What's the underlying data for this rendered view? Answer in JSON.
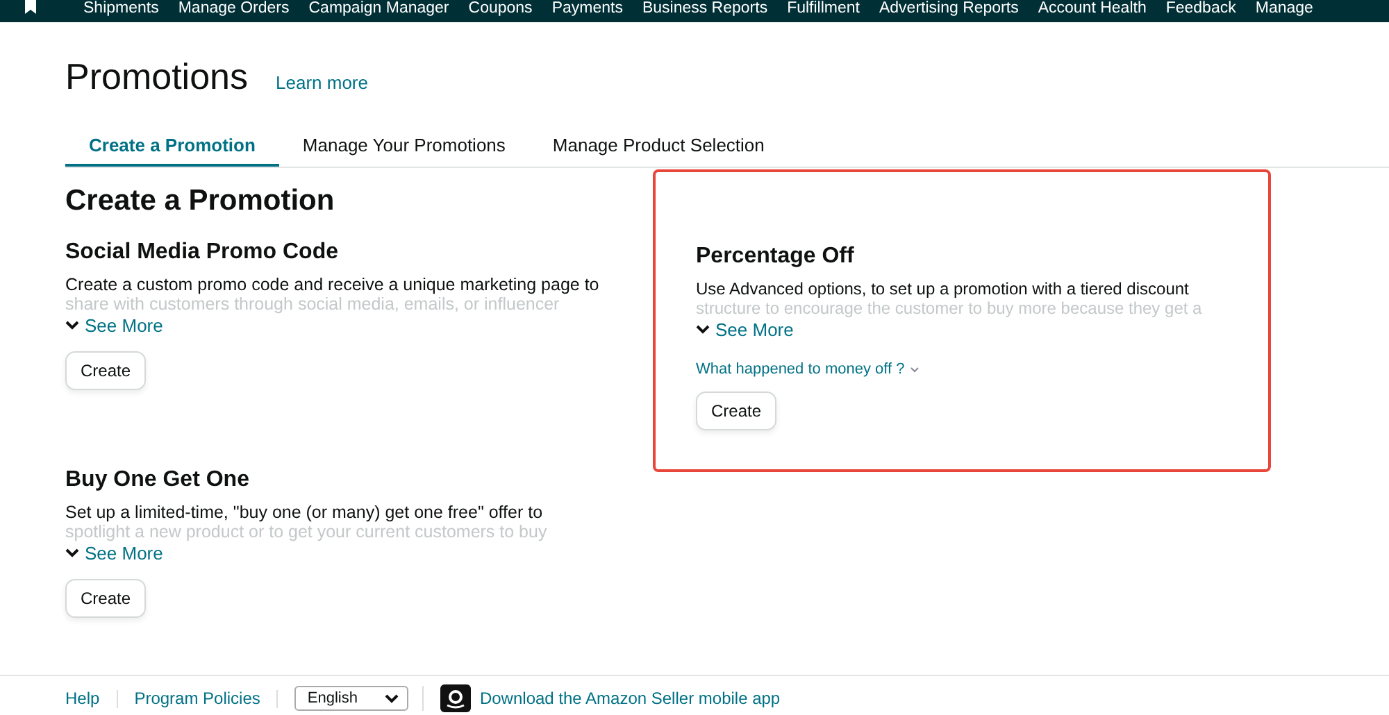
{
  "nav": {
    "items": [
      "Shipments",
      "Manage Orders",
      "Campaign Manager",
      "Coupons",
      "Payments",
      "Business Reports",
      "Fulfillment",
      "Advertising Reports",
      "Account Health",
      "Feedback",
      "Manage"
    ]
  },
  "page": {
    "title": "Promotions",
    "learn_more": "Learn more"
  },
  "tabs": [
    {
      "label": "Create a Promotion",
      "selected": true
    },
    {
      "label": "Manage Your Promotions",
      "selected": false
    },
    {
      "label": "Manage Product Selection",
      "selected": false
    }
  ],
  "section_title": "Create a Promotion",
  "promotions": [
    {
      "title": "Social Media Promo Code",
      "description": "Create a custom promo code and receive a unique marketing page to",
      "description_faded": "share with customers through social media, emails, or influencer",
      "see_more": "See More",
      "create": "Create",
      "highlighted": false
    },
    {
      "title": "Percentage Off",
      "description": "Use Advanced options, to set up a promotion with a tiered discount",
      "description_faded": "structure to encourage the customer to buy more because they get a",
      "see_more": "See More",
      "note_link": "What happened to money off ?",
      "create": "Create",
      "highlighted": true
    },
    {
      "title": "Buy One Get One",
      "description": "Set up a limited-time, \"buy one (or many) get one free\" offer to",
      "description_faded": "spotlight a new product or to get your current customers to buy",
      "see_more": "See More",
      "create": "Create",
      "highlighted": false
    }
  ],
  "footer": {
    "links": [
      "Help",
      "Program Policies"
    ],
    "language": "English",
    "app_link": "Download the Amazon Seller mobile app"
  }
}
